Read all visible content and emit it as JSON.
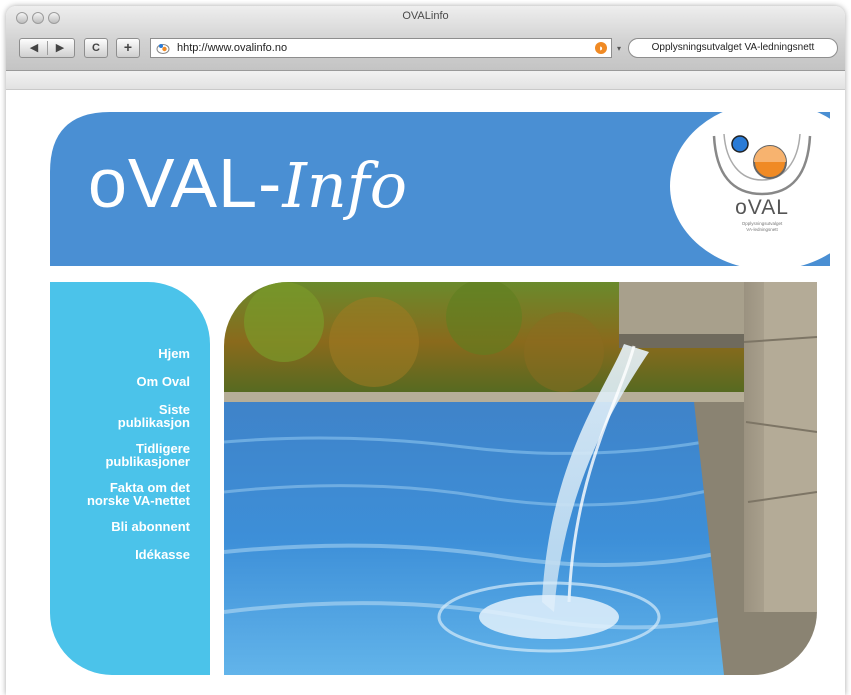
{
  "browser": {
    "window_title": "OVALinfo",
    "nav_back": "◀",
    "nav_forward": "▶",
    "reload": "C",
    "add": "+",
    "url": "hhtp://www.ovalinfo.no",
    "search_value": "Opplysningsutvalget VA-ledningsnett"
  },
  "header": {
    "title_oval": "oVAL-",
    "title_info": "Info",
    "band_color": "#4a8fd3"
  },
  "logo": {
    "text": "oVAL",
    "subtitle": "Opplysningsutvalget\nVA-ledningsnett",
    "icon": "oval-logo-icon"
  },
  "sidebar": {
    "color": "#4bc3ea",
    "items": [
      {
        "label": "Hjem"
      },
      {
        "label": "Om Oval"
      },
      {
        "label": "Siste\npublikasjon"
      },
      {
        "label": "Tidligere\npublikasjoner"
      },
      {
        "label": "Fakta om det\nnorske VA-nettet"
      },
      {
        "label": "Bli abonnent"
      },
      {
        "label": "Idékasse"
      }
    ]
  },
  "hero": {
    "image": "pool-waterfall-photo"
  }
}
